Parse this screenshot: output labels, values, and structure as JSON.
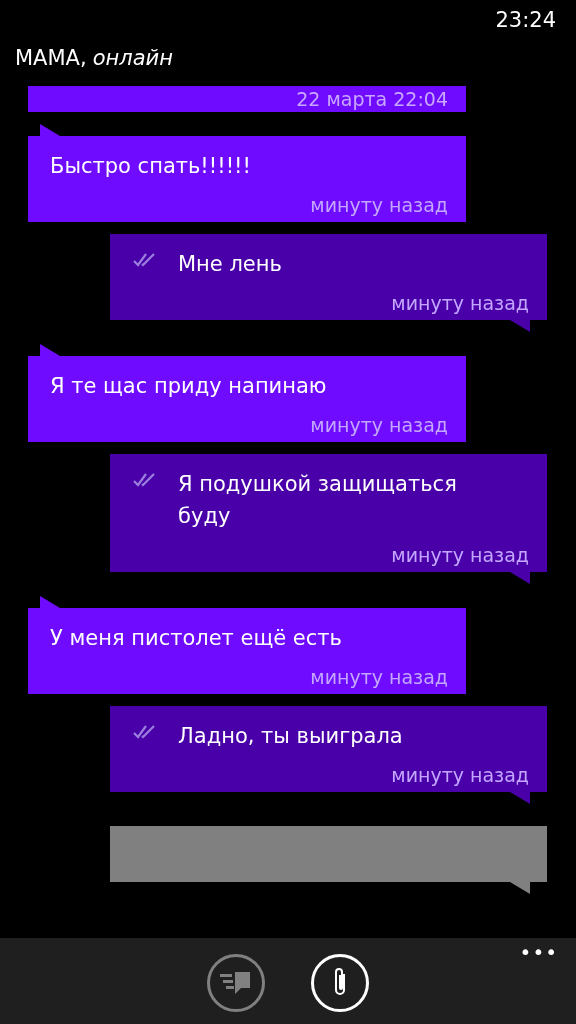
{
  "status_bar": {
    "time": "23:24"
  },
  "header": {
    "contact": "МАМА,",
    "presence": "онлайн"
  },
  "date_stamp": "22 марта 22:04",
  "messages": [
    {
      "kind": "incoming",
      "text": "Быстро спать!!!!!!",
      "time": "минуту назад"
    },
    {
      "kind": "outgoing",
      "text": "Мне лень",
      "time": "минуту назад"
    },
    {
      "kind": "incoming",
      "text": "Я те щас приду напинаю",
      "time": "минуту назад"
    },
    {
      "kind": "outgoing",
      "text": "Я подушкой защищаться буду",
      "time": "минуту назад"
    },
    {
      "kind": "incoming",
      "text": "У меня пистолет ещё есть",
      "time": "минуту назад"
    },
    {
      "kind": "outgoing",
      "text": "Ладно, ты выиграла",
      "time": "минуту назад"
    }
  ],
  "compose": {
    "disabled": false
  },
  "app_bar": {
    "send_disabled": true,
    "more": "•••"
  }
}
